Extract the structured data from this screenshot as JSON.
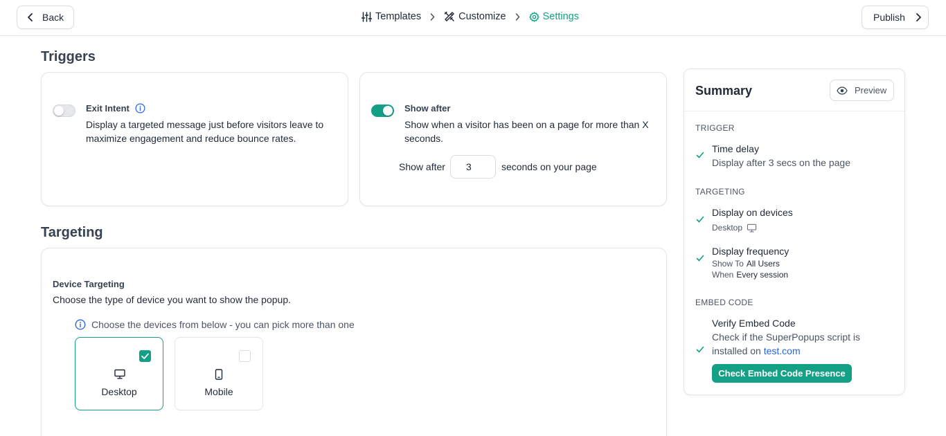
{
  "header": {
    "back_label": "Back",
    "publish_label": "Publish",
    "breadcrumbs": [
      {
        "label": "Templates",
        "icon": "sliders-icon"
      },
      {
        "label": "Customize",
        "icon": "tools-icon"
      },
      {
        "label": "Settings",
        "icon": "gear-icon",
        "active": true
      }
    ]
  },
  "colors": {
    "accent": "#14a085",
    "link": "#2563eb",
    "info": "#2563eb"
  },
  "triggers": {
    "title": "Triggers",
    "exit_intent": {
      "title": "Exit Intent",
      "enabled": false,
      "description": "Display a targeted message just before visitors leave to maximize engagement and reduce bounce rates."
    },
    "show_after": {
      "title": "Show after",
      "enabled": true,
      "description": "Show when a visitor has been on a page for more than X seconds.",
      "prefix": "Show after",
      "value": "3",
      "suffix": "seconds on your page"
    }
  },
  "targeting": {
    "title": "Targeting",
    "device_title": "Device Targeting",
    "device_description": "Choose the type of device you want to show the popup.",
    "info_text": "Choose the devices from below - you can pick more than one",
    "devices": [
      {
        "label": "Desktop",
        "checked": true,
        "icon": "desktop-icon"
      },
      {
        "label": "Mobile",
        "checked": false,
        "icon": "mobile-icon"
      }
    ]
  },
  "summary": {
    "title": "Summary",
    "preview_label": "Preview",
    "trigger_section": "TRIGGER",
    "time_delay_title": "Time delay",
    "time_delay_desc": "Display after 3 secs on the page",
    "targeting_section": "TARGETING",
    "devices_title": "Display on devices",
    "devices_value": "Desktop",
    "frequency_title": "Display frequency",
    "show_to_label": "Show To",
    "show_to_value": "All Users",
    "when_label": "When",
    "when_value": "Every session",
    "embed_section": "EMBED CODE",
    "verify_title": "Verify Embed Code",
    "verify_desc_1": "Check if the SuperPopups script is",
    "verify_desc_2": "installed on",
    "verify_domain": "test.com",
    "check_button": "Check Embed Code Presence"
  }
}
